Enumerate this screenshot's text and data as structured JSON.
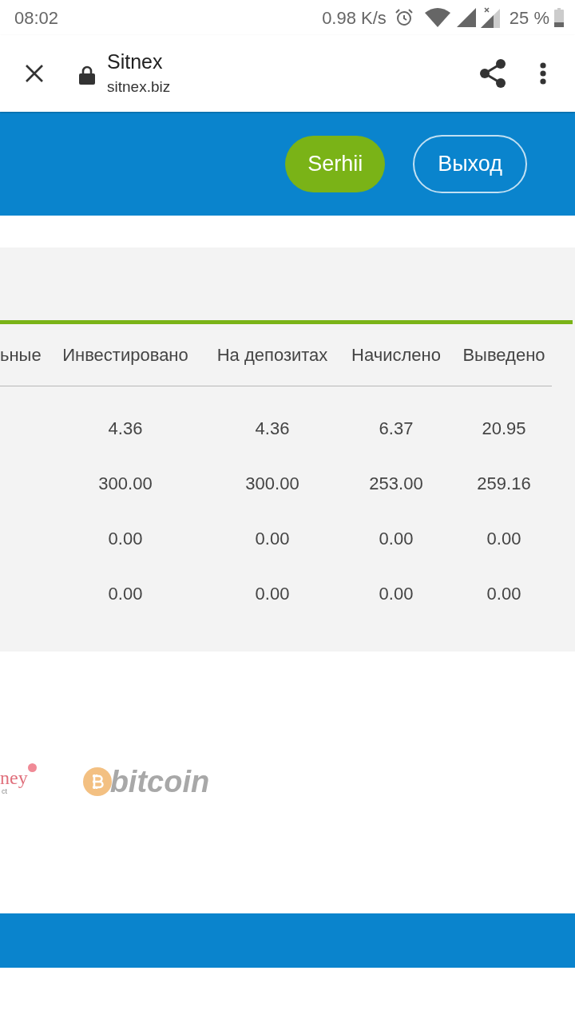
{
  "status_bar": {
    "time": "08:02",
    "network_speed": "0.98 K/s",
    "battery": "25 %"
  },
  "browser_toolbar": {
    "title": "Sitnex",
    "url": "sitnex.biz"
  },
  "header": {
    "buttons": [
      {
        "label": "Serhii",
        "kind": "filled"
      },
      {
        "label": "Выход",
        "kind": "outline"
      }
    ]
  },
  "table": {
    "columns": [
      "ьные",
      "Инвестировано",
      "На депозитах",
      "Начислено",
      "Выведено"
    ],
    "rows": [
      [
        "",
        "4.36",
        "4.36",
        "6.37",
        "20.95"
      ],
      [
        "",
        "300.00",
        "300.00",
        "253.00",
        "259.16"
      ],
      [
        "",
        "0.00",
        "0.00",
        "0.00",
        "0.00"
      ],
      [
        "",
        "0.00",
        "0.00",
        "0.00",
        "0.00"
      ]
    ]
  },
  "payment_logos": [
    {
      "kind": "wordmark",
      "text": "ney",
      "subtext": "ct"
    },
    {
      "kind": "bitcoin",
      "text": "bitcoin"
    }
  ]
}
